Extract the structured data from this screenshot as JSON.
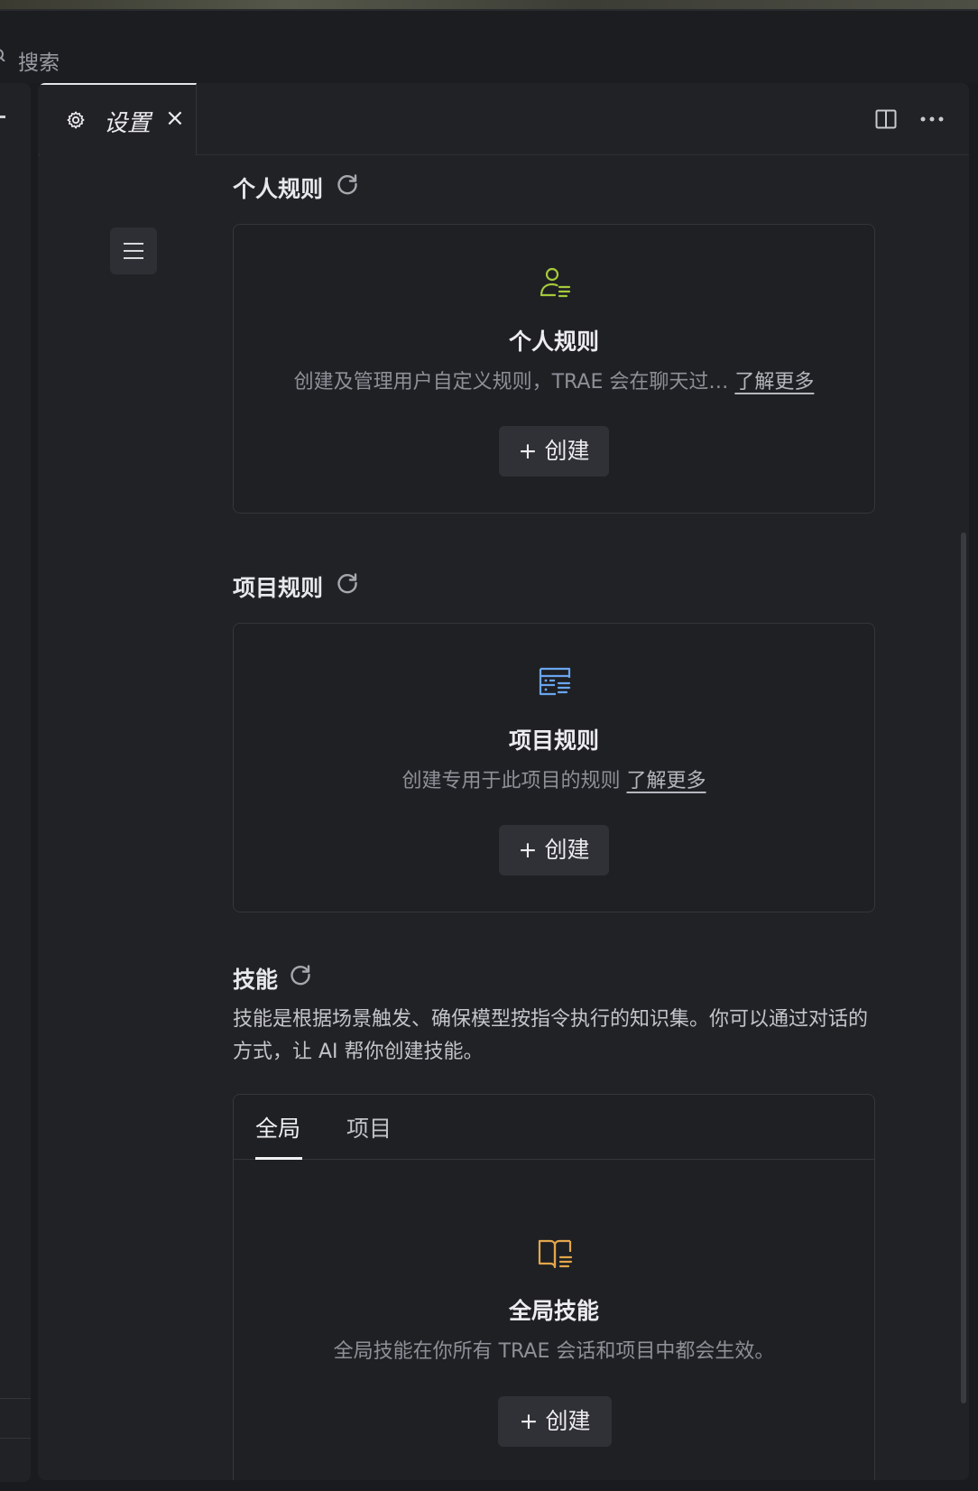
{
  "search": {
    "label": "搜索"
  },
  "tab": {
    "title": "设置",
    "close": "×"
  },
  "personal_rules": {
    "heading": "个人规则",
    "card_title": "个人规则",
    "card_desc": "创建及管理用户自定义规则，TRAE 会在聊天过…",
    "learn_more": "了解更多",
    "create": "+  创建"
  },
  "project_rules": {
    "heading": "项目规则",
    "card_title": "项目规则",
    "card_desc": "创建专用于此项目的规则",
    "learn_more": "了解更多",
    "create": "+  创建"
  },
  "skills": {
    "heading": "技能",
    "desc": "技能是根据场景触发、确保模型按指令执行的知识集。你可以通过对话的方式，让 AI 帮你创建技能。",
    "tabs": [
      "全局",
      "项目"
    ],
    "card_title": "全局技能",
    "card_desc": "全局技能在你所有 TRAE 会话和项目中都会生效。",
    "create": "+ 创建"
  },
  "colors": {
    "personal_icon": "#a6c93a",
    "project_icon": "#6aa6f0",
    "skills_icon": "#e3a64a"
  }
}
